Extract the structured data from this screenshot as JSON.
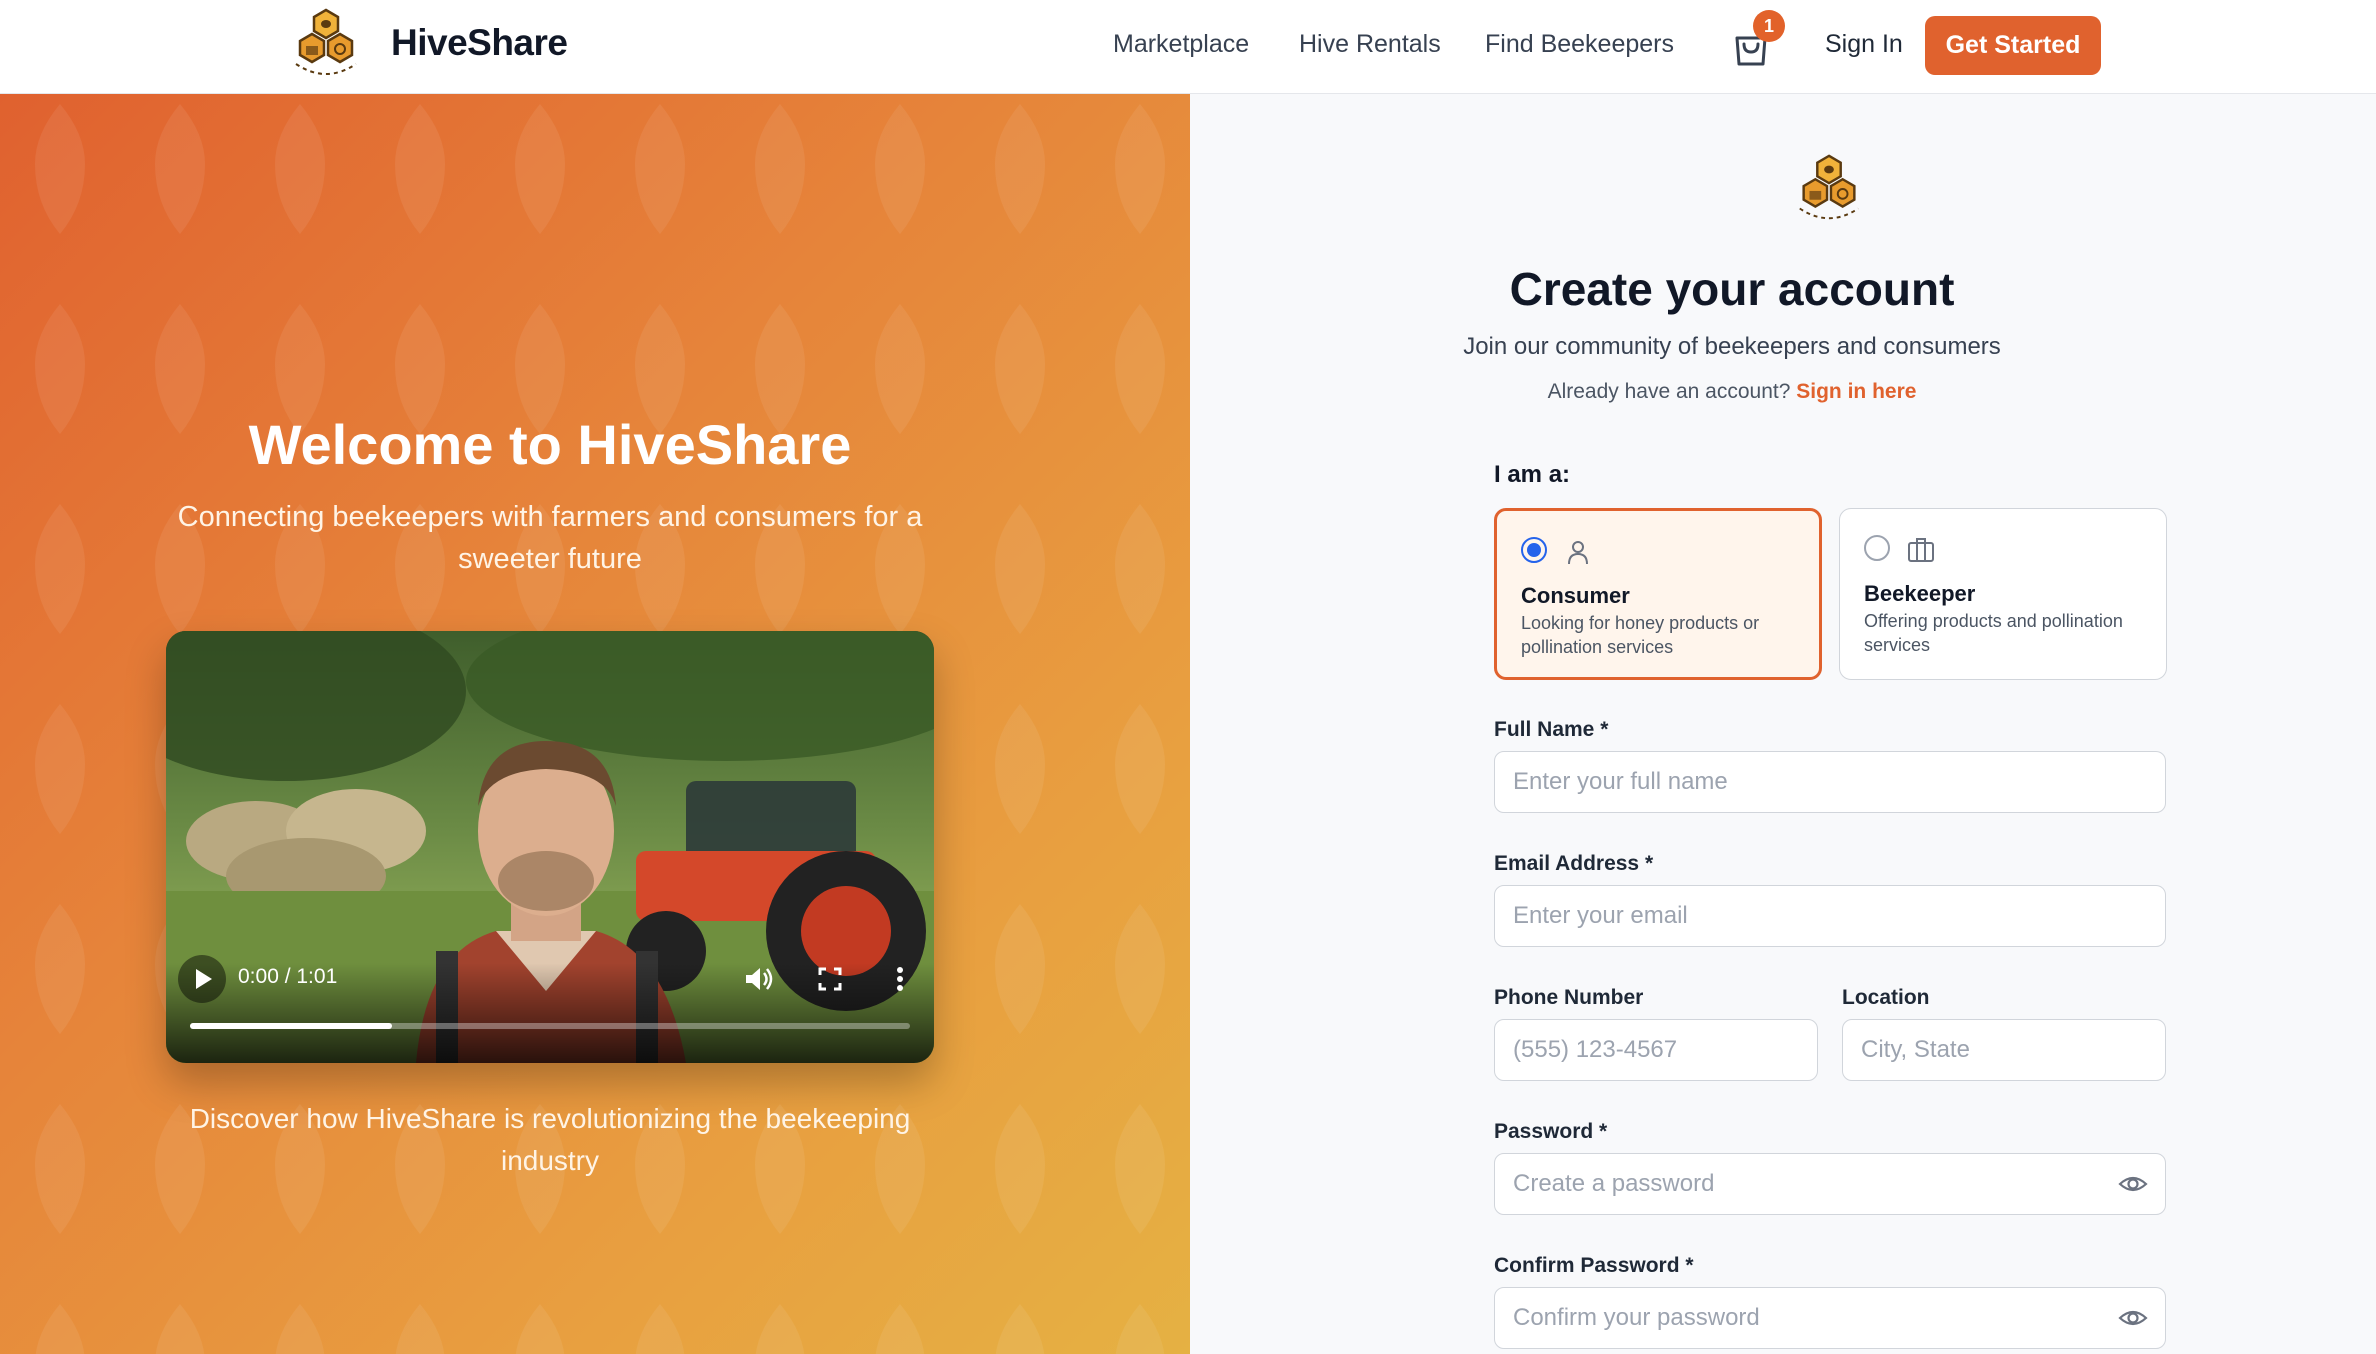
{
  "header": {
    "brand": "HiveShare",
    "nav": [
      "Marketplace",
      "Hive Rentals",
      "Find Beekeepers"
    ],
    "cart_count": "1",
    "sign_in": "Sign In",
    "cta": "Get Started"
  },
  "hero": {
    "title": "Welcome to HiveShare",
    "subtitle": "Connecting beekeepers with farmers and consumers for a sweeter future",
    "video": {
      "time": "0:00 / 1:01",
      "progress": 0.28
    },
    "caption": "Discover how HiveShare is revolutionizing the beekeeping industry"
  },
  "form": {
    "title": "Create your account",
    "subtitle": "Join our community of beekeepers and consumers",
    "signin_prompt": "Already have an account?",
    "signin_link": "Sign in here",
    "role_label": "I am a:",
    "roles": [
      {
        "name": "Consumer",
        "desc": "Looking for honey products or pollination services",
        "selected": true
      },
      {
        "name": "Beekeeper",
        "desc": "Offering products and pollination services",
        "selected": false
      }
    ],
    "fields": {
      "full_name": {
        "label": "Full Name *",
        "placeholder": "Enter your full name"
      },
      "email": {
        "label": "Email Address *",
        "placeholder": "Enter your email"
      },
      "phone": {
        "label": "Phone Number",
        "placeholder": "(555) 123-4567"
      },
      "location": {
        "label": "Location",
        "placeholder": "City, State"
      },
      "password": {
        "label": "Password *",
        "placeholder": "Create a password"
      },
      "confirm_password": {
        "label": "Confirm Password *",
        "placeholder": "Confirm your password"
      }
    }
  },
  "colors": {
    "accent": "#e0622e",
    "radio": "#2563eb"
  }
}
